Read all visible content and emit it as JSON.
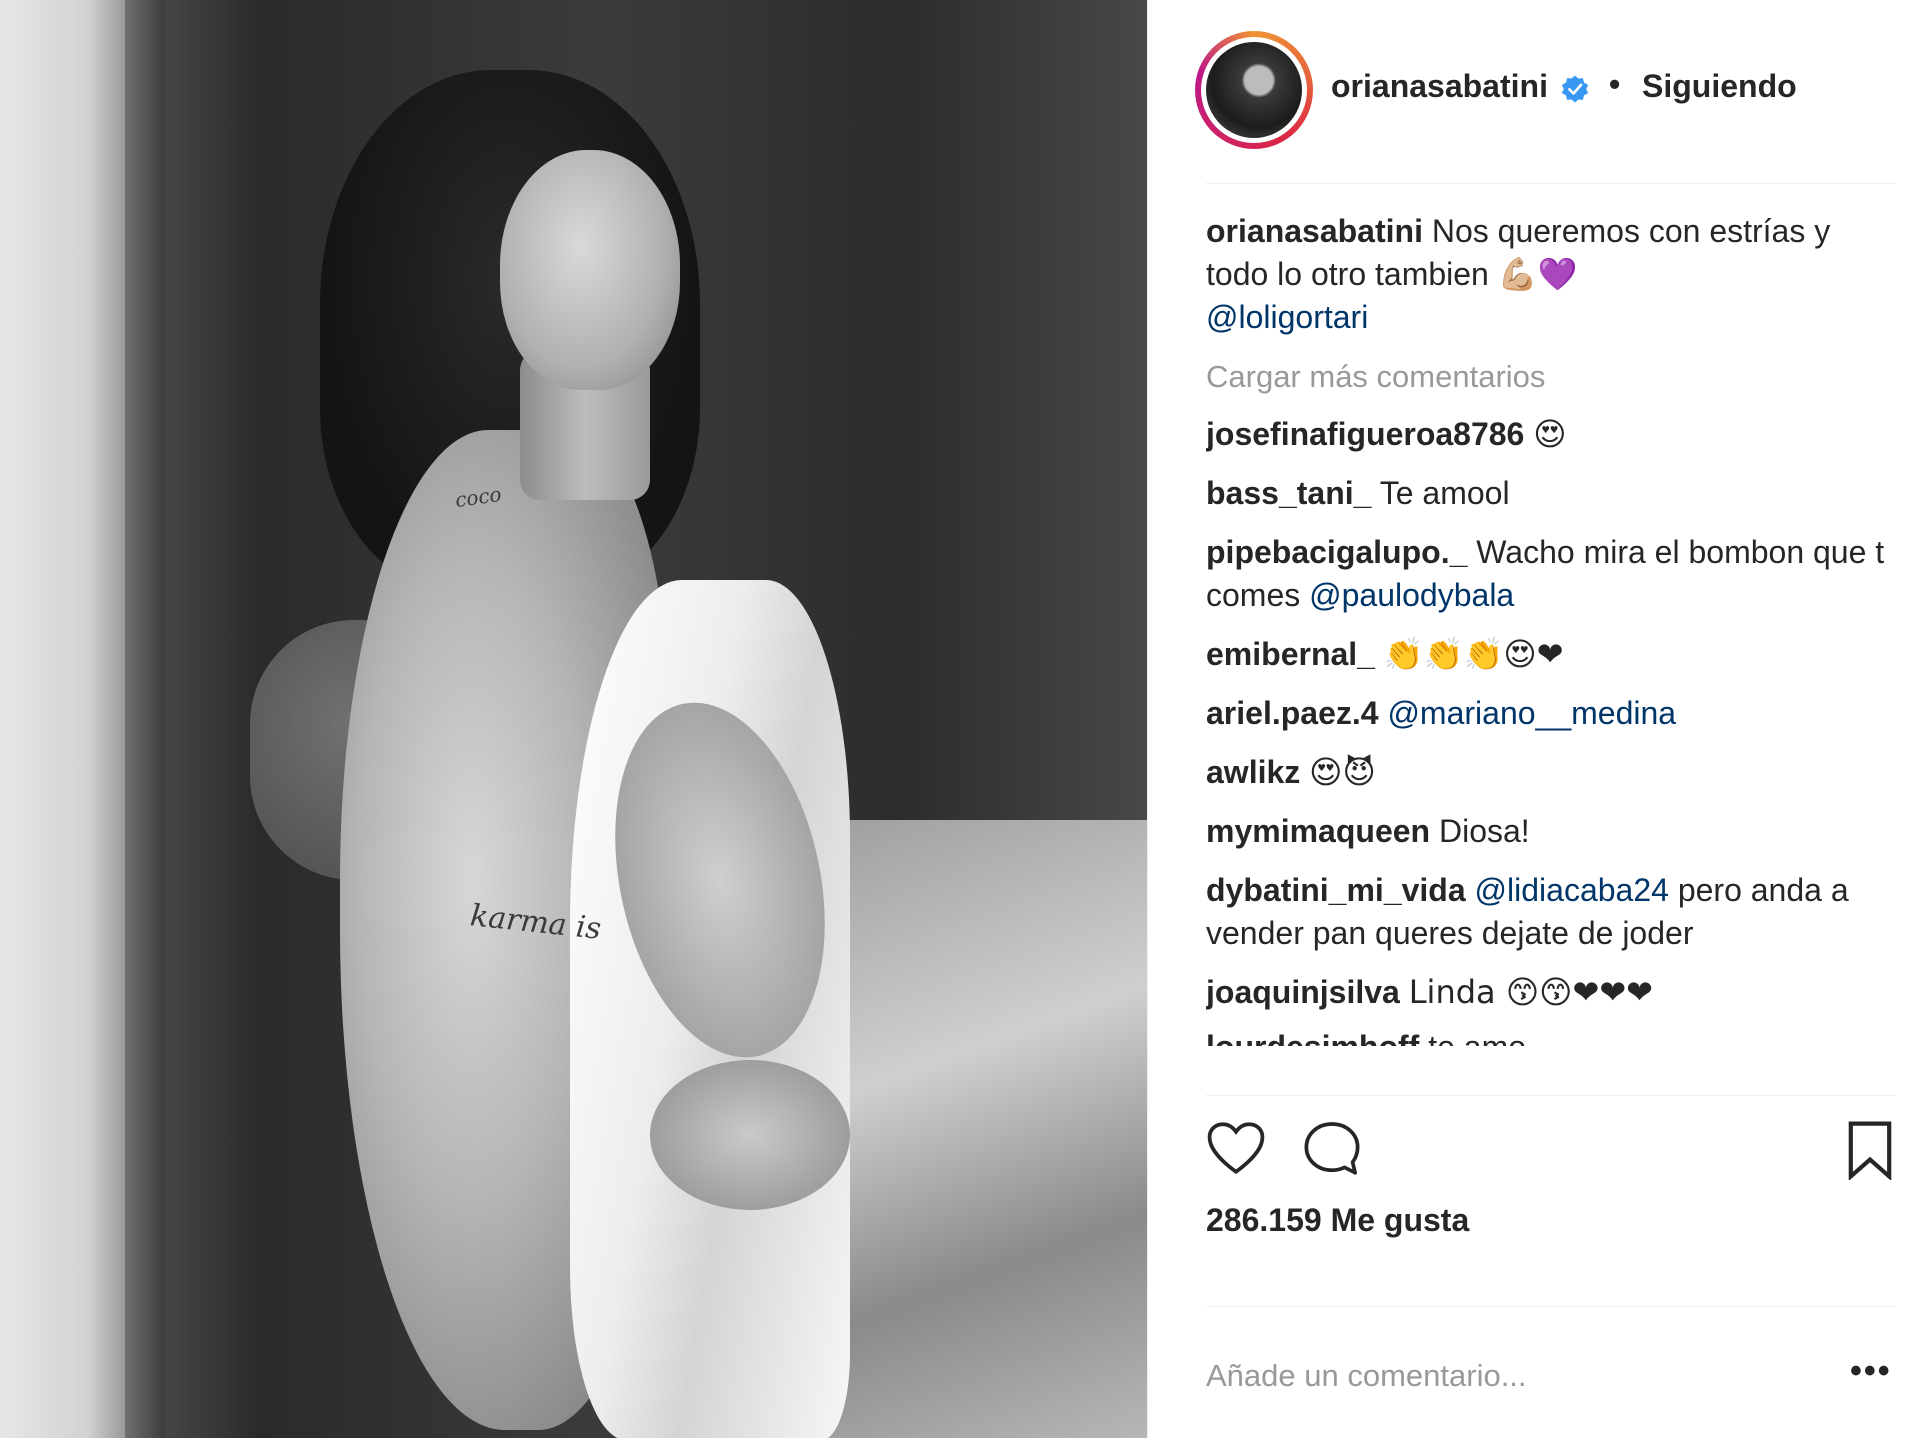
{
  "post": {
    "username": "orianasabatini",
    "follow_status": "Siguiendo",
    "separator": "•",
    "verified": true,
    "caption": {
      "user": "orianasabatini",
      "text": "Nos queremos con estrías y todo lo otro tambien 💪🏼💜",
      "mention": "@loligortari"
    },
    "load_more": "Cargar más comentarios",
    "comments": [
      {
        "user": "josefinafigueroa8786",
        "text": "😍",
        "mention": ""
      },
      {
        "user": "bass_tani_",
        "text": "Te amool",
        "mention": ""
      },
      {
        "user": "pipebacigalupo._",
        "text": "Wacho mira el bombon que t comes",
        "mention": "@paulodybala"
      },
      {
        "user": "emibernal_",
        "text": "👏👏👏😍❤",
        "mention": ""
      },
      {
        "user": "ariel.paez.4",
        "text": "",
        "mention": "@mariano__medina"
      },
      {
        "user": "awlikz",
        "text": "😍😈",
        "mention": ""
      },
      {
        "user": "mymimaqueen",
        "text": "Diosa!",
        "mention": ""
      },
      {
        "user": "dybatini_mi_vida",
        "text_before": "",
        "mention": "@lidiacaba24",
        "text": "pero anda a vender pan queres dejate de joder"
      },
      {
        "user": "joaquinjsilva",
        "text": "Linda 😙😙❤❤❤",
        "mention": ""
      },
      {
        "user": "lourdesimhoff",
        "text": "te amo",
        "mention": ""
      }
    ],
    "likes": "286.159 Me gusta",
    "add_comment_placeholder": "Añade un comentario...",
    "more_options": "•••"
  },
  "photo": {
    "tattoo_1": "coco",
    "tattoo_2": "karma is"
  },
  "colors": {
    "text": "#262626",
    "muted": "#999999",
    "mention": "#003569",
    "verified": "#3897f0",
    "divider": "#efefef"
  },
  "icons": [
    "verified-badge-icon",
    "heart-icon",
    "comment-bubble-icon",
    "bookmark-icon",
    "more-options-icon"
  ]
}
